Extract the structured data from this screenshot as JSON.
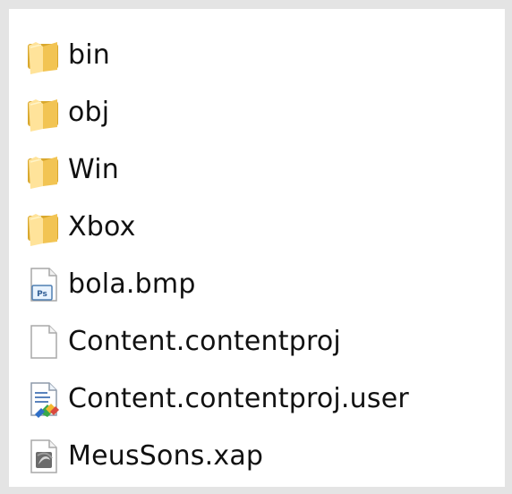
{
  "file_list": {
    "items": [
      {
        "name": "bin",
        "kind": "folder",
        "icon": "folder-icon"
      },
      {
        "name": "obj",
        "kind": "folder",
        "icon": "folder-icon"
      },
      {
        "name": "Win",
        "kind": "folder",
        "icon": "folder-icon"
      },
      {
        "name": "Xbox",
        "kind": "folder",
        "icon": "folder-icon"
      },
      {
        "name": "bola.bmp",
        "kind": "file",
        "icon": "photoshop-file-icon"
      },
      {
        "name": "Content.contentproj",
        "kind": "file",
        "icon": "blank-file-icon"
      },
      {
        "name": "Content.contentproj.user",
        "kind": "file",
        "icon": "user-settings-file-icon"
      },
      {
        "name": "MeusSons.xap",
        "kind": "file",
        "icon": "xap-package-icon"
      }
    ]
  },
  "colors": {
    "frame": "#e4e4e4",
    "folder": "#f2c453",
    "text": "#111111"
  }
}
